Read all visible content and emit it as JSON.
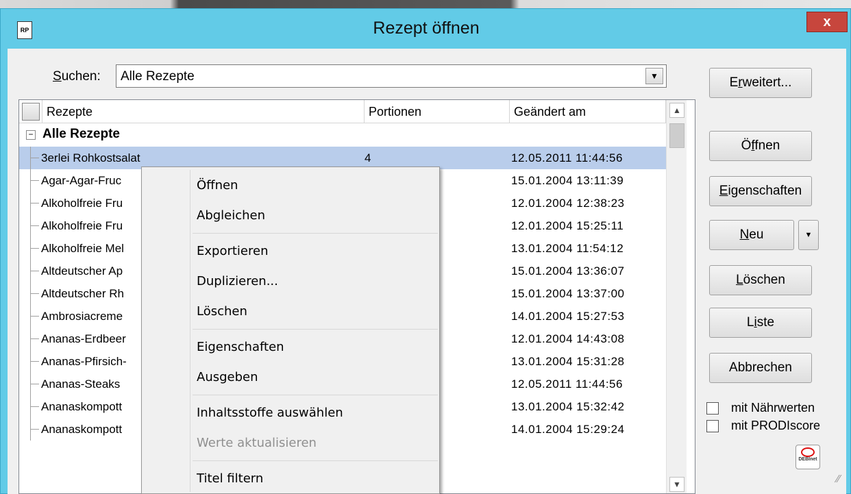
{
  "window": {
    "title": "Rezept öffnen",
    "icon_label": "RP",
    "close_label": "x"
  },
  "search": {
    "label_accel": "S",
    "label_rest": "uchen:",
    "value": "Alle Rezepte"
  },
  "buttons": {
    "erweitert_accel": "r",
    "erweitert_pre": "E",
    "erweitert_post": "weitert...",
    "oeffnen_pre": "Ö",
    "oeffnen_accel": "f",
    "oeffnen_post": "fnen",
    "eigenschaften_accel": "E",
    "eigenschaften_post": "igenschaften",
    "neu_accel": "N",
    "neu_post": "eu",
    "loeschen_accel": "L",
    "loeschen_post": "öschen",
    "liste_pre": "L",
    "liste_accel": "i",
    "liste_post": "ste",
    "abbrechen": "Abbrechen"
  },
  "checkboxes": {
    "naehrwerte": "mit Nährwerten",
    "prodiscore": "mit PRODIscore"
  },
  "logo_text": "DEBInet",
  "table": {
    "columns": [
      "Rezepte",
      "Portionen",
      "Geändert am"
    ],
    "group_label": "Alle Rezepte",
    "rows": [
      {
        "name": "3erlei Rohkostsalat",
        "portionen": "4",
        "date": "12.05.2011 11:44:56"
      },
      {
        "name": "Agar-Agar-Fruc",
        "portionen": "",
        "date": "15.01.2004 13:11:39"
      },
      {
        "name": "Alkoholfreie Fru",
        "portionen": "",
        "date": "12.01.2004 12:38:23"
      },
      {
        "name": "Alkoholfreie Fru",
        "portionen": "",
        "date": "12.01.2004 15:25:11"
      },
      {
        "name": "Alkoholfreie Mel",
        "portionen": "",
        "date": "13.01.2004 11:54:12"
      },
      {
        "name": "Altdeutscher Ap",
        "portionen": "",
        "date": "15.01.2004 13:36:07"
      },
      {
        "name": "Altdeutscher Rh",
        "portionen": "",
        "date": "15.01.2004 13:37:00"
      },
      {
        "name": "Ambrosiacreme",
        "portionen": "",
        "date": "14.01.2004 15:27:53"
      },
      {
        "name": "Ananas-Erdbeer",
        "portionen": "",
        "date": "12.01.2004 14:43:08"
      },
      {
        "name": "Ananas-Pfirsich-",
        "portionen": "",
        "date": "13.01.2004 15:31:28"
      },
      {
        "name": "Ananas-Steaks",
        "portionen": "",
        "date": "12.05.2011 11:44:56"
      },
      {
        "name": "Ananaskompott",
        "portionen": "",
        "date": "13.01.2004 15:32:42"
      },
      {
        "name": "Ananaskompott",
        "portionen": "",
        "date": "14.01.2004 15:29:24"
      }
    ]
  },
  "context_menu": {
    "items": [
      "Öffnen",
      "Abgleichen",
      "Exportieren",
      "Duplizieren...",
      "Löschen",
      "Eigenschaften",
      "Ausgeben",
      "Inhaltsstoffe auswählen",
      "Werte aktualisieren",
      "Titel filtern"
    ]
  },
  "colors": {
    "title_bar": "#62cbe7",
    "close_button": "#c7463d",
    "selection": "#b9cdeb"
  }
}
